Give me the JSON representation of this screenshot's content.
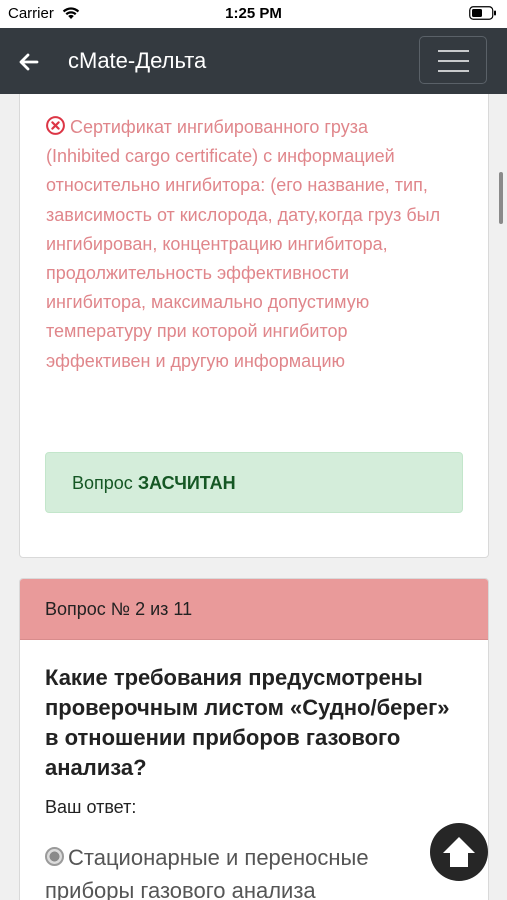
{
  "status_bar": {
    "carrier": "Carrier",
    "time": "1:25 PM"
  },
  "navbar": {
    "title": "cMate-Дельта",
    "back_icon": "arrow-left-icon",
    "menu_icon": "hamburger-menu-icon",
    "background": "#343a40"
  },
  "previous_question": {
    "wrong_answer_icon": "circle-x-icon",
    "wrong_answer_text": "Сертификат ингибированного груза (Inhibited cargo certificate) с информацией относительно ингибитора: (его название, тип, зависимость от кислорода, дату,когда груз был ингибирован, концентрацию ингибитора, продолжительность эффективности ингибитора, максимально допустимую температуру при которой ингибитор эффективен и другую информацию",
    "result_prefix": "Вопрос",
    "result_status": "ЗАСЧИТАН",
    "error_color": "#e0868b",
    "success_color": "#d4edda"
  },
  "current_question": {
    "header": "Вопрос № 2 из 11",
    "header_color": "#e99a9a",
    "text": "Какие требования предусмотрены проверочным листом «Судно/берег» в отношении приборов газового анализа?",
    "your_answer_label": "Ваш ответ:",
    "selected_option": "Стационарные и переносные приборы газового анализа"
  },
  "scroll_top_icon": "arrow-up-circle-icon"
}
